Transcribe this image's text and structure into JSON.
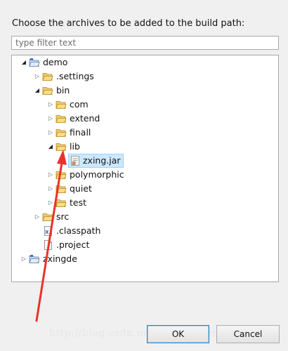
{
  "dialog": {
    "prompt": "Choose the archives to be added to the build path:",
    "filter_placeholder": "type filter text",
    "ok_label": "OK",
    "cancel_label": "Cancel"
  },
  "tree": {
    "demo": {
      "label": "demo",
      "state": "expanded",
      "icon": "project-icon"
    },
    "settings": {
      "label": ".settings",
      "state": "collapsed",
      "icon": "folder-icon"
    },
    "bin": {
      "label": "bin",
      "state": "expanded",
      "icon": "folder-icon"
    },
    "com": {
      "label": "com",
      "state": "collapsed",
      "icon": "folder-icon"
    },
    "extend": {
      "label": "extend",
      "state": "collapsed",
      "icon": "folder-icon"
    },
    "finall": {
      "label": "finall",
      "state": "collapsed",
      "icon": "folder-icon"
    },
    "lib": {
      "label": "lib",
      "state": "expanded",
      "icon": "folder-icon"
    },
    "zxing_jar": {
      "label": "zxing.jar",
      "selected": true,
      "icon": "jar-icon"
    },
    "polymorphic": {
      "label": "polymorphic",
      "state": "collapsed",
      "icon": "folder-icon"
    },
    "quiet": {
      "label": "quiet",
      "state": "collapsed",
      "icon": "folder-icon"
    },
    "test": {
      "label": "test",
      "state": "collapsed",
      "icon": "folder-icon"
    },
    "src": {
      "label": "src",
      "state": "collapsed",
      "icon": "folder-icon"
    },
    "classpath": {
      "label": ".classpath",
      "icon": "xml-file-icon"
    },
    "project": {
      "label": ".project",
      "icon": "file-icon"
    },
    "zxingde": {
      "label": "zxingde",
      "state": "collapsed",
      "icon": "project-icon"
    }
  },
  "watermark": "http://blog.csdn.net/a_zhangsen_lie",
  "colors": {
    "annotation_arrow": "#e8322c",
    "selection_bg": "#cce8ff",
    "folder": "#e8b84a"
  }
}
